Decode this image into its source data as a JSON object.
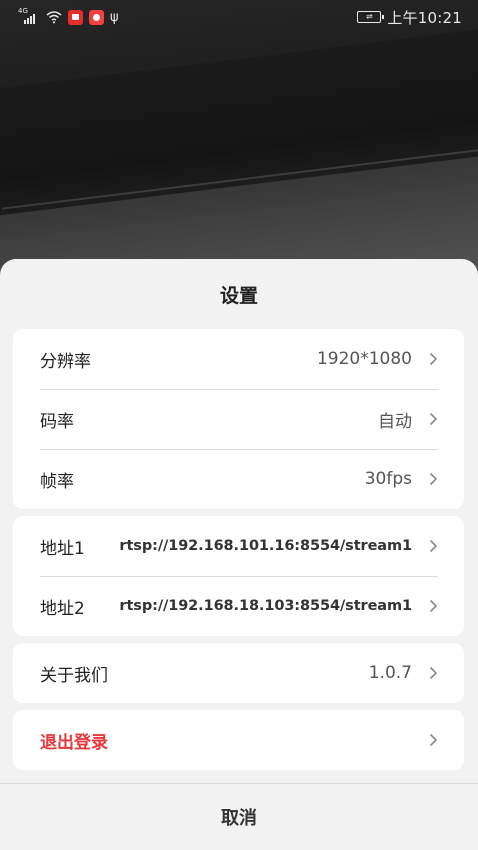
{
  "status_bar": {
    "signal_label": "4G",
    "time": "上午10:21",
    "icons": [
      "signal-icon",
      "wifi-icon",
      "app-notification-icon",
      "app-notification-icon",
      "usb-icon",
      "battery-charging-icon"
    ]
  },
  "sheet": {
    "title": "设置",
    "video_group": [
      {
        "label": "分辨率",
        "value": "1920*1080",
        "icon": "chevron-right-icon"
      },
      {
        "label": "码率",
        "value": "自动",
        "icon": "chevron-right-icon"
      },
      {
        "label": "帧率",
        "value": "30fps",
        "icon": "chevron-right-icon"
      }
    ],
    "address_group": [
      {
        "label": "地址1",
        "value": "rtsp://192.168.101.16:8554/stream1",
        "icon": "chevron-right-icon"
      },
      {
        "label": "地址2",
        "value": "rtsp://192.168.18.103:8554/stream1",
        "icon": "chevron-right-icon"
      }
    ],
    "about": {
      "label": "关于我们",
      "value": "1.0.7",
      "icon": "chevron-right-icon"
    },
    "logout": {
      "label": "退出登录",
      "icon": "chevron-right-icon"
    },
    "cancel_label": "取消"
  },
  "colors": {
    "sheet_bg": "#f2f2f2",
    "card_bg": "#ffffff",
    "danger": "#e8363a"
  }
}
